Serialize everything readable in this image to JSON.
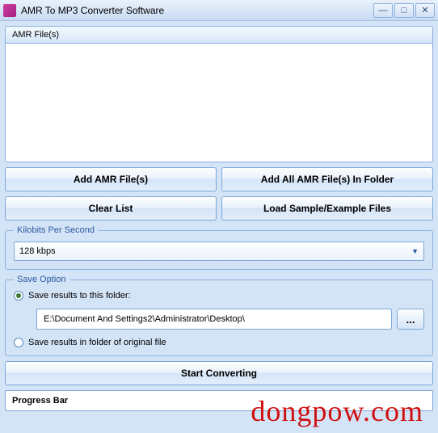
{
  "window": {
    "title": "AMR To MP3 Converter Software"
  },
  "file_panel": {
    "header": "AMR File(s)"
  },
  "buttons": {
    "add_files": "Add AMR File(s)",
    "add_folder": "Add All AMR File(s) In Folder",
    "clear": "Clear List",
    "load_sample": "Load Sample/Example Files",
    "start": "Start Converting",
    "browse": "..."
  },
  "kbps": {
    "legend": "Kilobits Per Second",
    "value": "128 kbps"
  },
  "save": {
    "legend": "Save Option",
    "opt_folder": "Save results to this folder:",
    "opt_original": "Save results in folder of original file",
    "folder_path": "E:\\Document And Settings2\\Administrator\\Desktop\\"
  },
  "progress": {
    "label": "Progress Bar"
  },
  "watermark": "dongpow.com"
}
